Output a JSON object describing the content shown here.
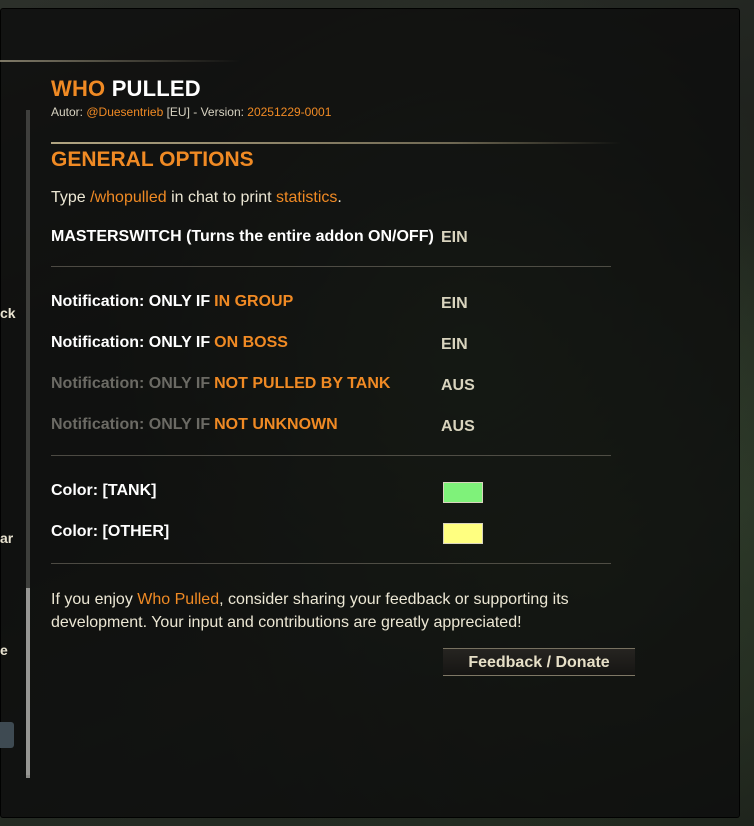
{
  "left_fragments": [
    "ck",
    "ar",
    "e"
  ],
  "header": {
    "title_accent": "WHO",
    "title_main": "PULLED",
    "author_prefix": "Autor: ",
    "author_name": "@Duesentrieb",
    "author_mid": " [EU] - Version: ",
    "version": "20251229-0001"
  },
  "section": {
    "title": "GENERAL OPTIONS",
    "intro_pre": "Type ",
    "intro_cmd": "/whopulled",
    "intro_mid": " in chat to print ",
    "intro_hl": "statistics",
    "intro_post": "."
  },
  "options": {
    "masterswitch_label": "MASTERSWITCH (Turns the entire addon ON/OFF)",
    "masterswitch_value": "EIN",
    "notif_prefix": "Notification: ONLY IF",
    "in_group": {
      "cond": "IN GROUP",
      "value": "EIN"
    },
    "on_boss": {
      "cond": "ON BOSS",
      "value": "EIN"
    },
    "not_tank": {
      "cond": "NOT PULLED BY TANK",
      "value": "AUS"
    },
    "not_unknown": {
      "cond": "NOT UNKNOWN",
      "value": "AUS"
    }
  },
  "colors": {
    "tank_label": "Color: [TANK]",
    "tank_color": "#7ff27a",
    "other_label": "Color: [OTHER]",
    "other_color": "#ffff80"
  },
  "footer": {
    "pre": "If you enjoy ",
    "addon": "Who Pulled",
    "post": ", consider sharing your feedback or supporting its development. Your input and contributions are greatly appreciated!",
    "button_label": "Feedback / Donate"
  }
}
